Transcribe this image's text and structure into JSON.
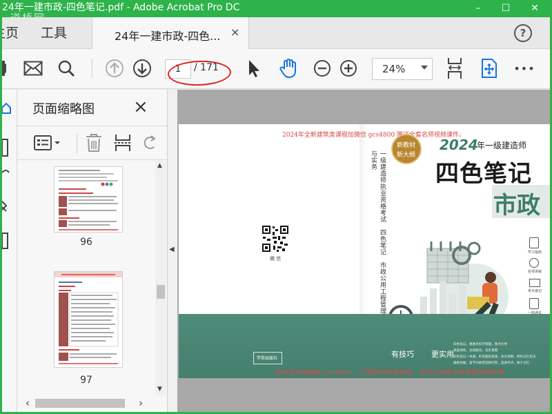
{
  "window": {
    "title": "24年一建市政-四色笔记.pdf - Adobe Acrobat Pro DC",
    "watermark": "道桥网",
    "controls": {
      "minimize": "–",
      "maximize": "☐",
      "close": "✕"
    }
  },
  "menu": {
    "home": "主页",
    "tools": "工具",
    "doc_tab": "24年一建市政-四色...",
    "doc_tab_close": "×",
    "help": "?"
  },
  "toolbar": {
    "page_current": "1",
    "page_total": "/ 171",
    "zoom": "24%",
    "more": "•••"
  },
  "thumb_panel": {
    "title": "页面缩略图",
    "close": "×",
    "pages": [
      {
        "number": "96"
      },
      {
        "number": "97"
      }
    ],
    "scroll_up": "▲",
    "scroll_down": "▼",
    "scroll_left": "‹",
    "scroll_right": "›",
    "collapse_arrow": "◀"
  },
  "cover": {
    "top_watermark": "2024年全新建筑类课程加微信 gcs4800 赠送全套名师视频课件。",
    "badge_line1": "新教材",
    "badge_line2": "新大纲",
    "year": "2024",
    "year_suffix": "年一级建造师",
    "main_title": "四色笔记",
    "subject": "市政",
    "spine_text": "一级建造师执业资格考试　四色笔记　市政公用工程管理与实务",
    "qr_caption": "微 信",
    "slogan_left": "有技巧",
    "slogan_right": "更实用",
    "side_features": [
      "学习指南",
      "名师讲解",
      "考点速记",
      "一题通关"
    ],
    "bottom_desc": [
      "四色笔记，重难点科学梳理，重点引导",
      "真题演练，总结解读，答实掌握",
      "四色笔记一本通，彩色图表直观，表达讲解，特色记忆招法",
      "编委会推，督节归纳营造顾问和，直通考点，要于记忆"
    ],
    "bottom_watermark": "有关资料加微信 gcs4800 ，下载资料免费查看，也可以选择在线观看视频资源",
    "publisher_stamp": "学苑出版社"
  },
  "colors": {
    "titlebar": "#2db34a",
    "cover_green": "#4f8c79",
    "cover_title": "#1b1b1b",
    "subject_green": "#3d7d6a",
    "watermark_red": "#d64a4a",
    "annotation_red": "#e02020",
    "icon_blue": "#1473e6"
  }
}
